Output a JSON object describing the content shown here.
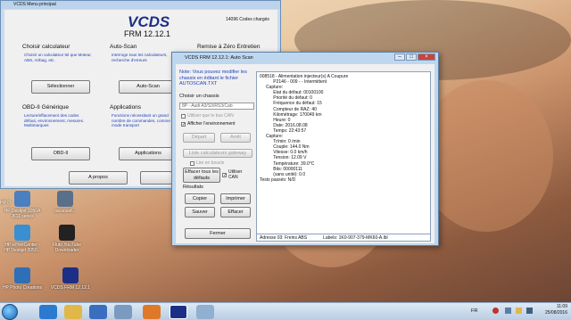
{
  "desktop": {
    "icons": [
      {
        "label": "HP Deskjet 3050A J611 series",
        "color": "#4a7fc0"
      },
      {
        "label": "cacaouell...",
        "color": "#5a6f8a"
      },
      {
        "label": "HP ePrintCenter - HP Deskjet 3050...",
        "color": "#3a8fd0"
      },
      {
        "label": "Fluto YouTube Downloader",
        "color": "#222222"
      },
      {
        "label": "HP Photo Creations",
        "color": "#2e6fb8"
      },
      {
        "label": "VCDS FRM 12.12.1",
        "color": "#1c2f86"
      }
    ],
    "prefix_label": "HP D"
  },
  "main_window": {
    "title": "VCDS Menu principal",
    "logo": "VCDS",
    "version": "FRM 12.12.1",
    "codes_count": "14096 Codes chargés",
    "sections": {
      "select_controller": {
        "title": "Choisir calculateur",
        "text": "Choisir un calculateur tel que Moteur, ABS, Airbag, etc.",
        "button": "Sélectionner"
      },
      "autoscan": {
        "title": "Auto-Scan",
        "text": "Interroge tous les calculateurs, recherche d'erreurs",
        "button": "Auto-Scan"
      },
      "reset": {
        "title": "Remise à Zéro Entretien"
      },
      "obd": {
        "title": "OBD-II Générique",
        "text": "Lecture/effacement des codes défaut, environnement, mesures. Multimarques",
        "button": "OBD-II"
      },
      "applications": {
        "title": "Applications",
        "text": "Fonctions nécessitant un grand nombre de commandes, comme le mode transport",
        "button": "Applications"
      }
    },
    "about_button": "A propos"
  },
  "scan_window": {
    "title": "VCDS FRM 12.12.1:  Auto Scan",
    "note": "Note:  Vous pouvez modifier les chassis en éditant le fichier AUTOSCAN.TXT",
    "chassis_label": "Choisir un chassis",
    "chassis_value": "8P - Audi A3/S3/RS3/Cab",
    "use_can_bus": "Utiliser que le bus CAN",
    "show_env": "Afficher l'environnement",
    "start_button": "Départ",
    "stop_button": "Arrêt",
    "gateway_button": "Liste calculateurs gateway",
    "loop_label": "Lire en boucle",
    "clear_all_button": "Effacer tous les défauts",
    "use_can": "Utiliser CAN",
    "results_label": "Résultats",
    "copy_button": "Copier",
    "print_button": "Imprimer",
    "save_button": "Sauver",
    "clear_button": "Effacer",
    "close_button": "Fermer",
    "results_lines": [
      "008518 - Alimentation injecteur(s) A Coupure",
      "           P2146 - 009 - - Intermittent",
      "     Capture:",
      "           Etat du défaut: 00100100",
      "           Priorité du défaut: 0",
      "           Fréquence du défaut: 15",
      "           Compteur de RAZ: 40",
      "           Kilométrage: 170049 km",
      "           Heure: 0",
      "           Date: 2016.08.08",
      "           Temps: 22:43:57",
      "",
      "     Capture:",
      "           Tr/min: 0 /min",
      "           Couple: 144.0 Nm",
      "           Vitesse: 0.0 km/h",
      "           Tension: 12.09 V",
      "           Température: 39.0°C",
      "           Bits: 00000111",
      "           (sans unité): 0.0",
      "",
      "Tests passés: N/D"
    ],
    "status_address": "Adresse 03: Freins ABS",
    "status_labels": "Labels:  1K0-907-379-MK60-A.lbl"
  },
  "taskbar": {
    "language": "FR",
    "time": "11:09",
    "date": "25/08/2016"
  }
}
